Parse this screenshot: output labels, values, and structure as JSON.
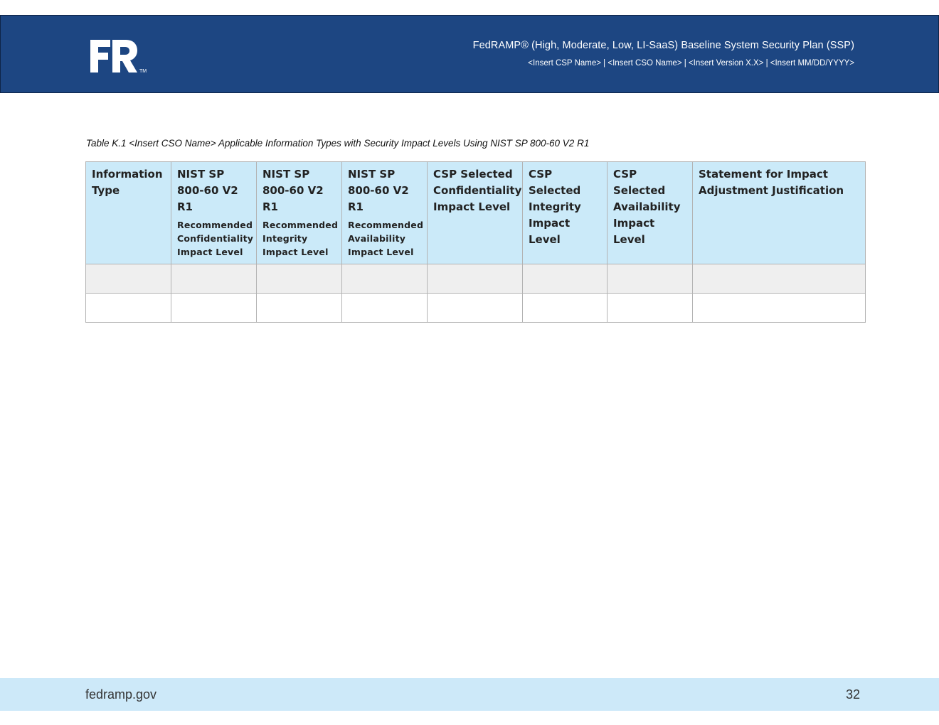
{
  "header": {
    "logo": "FR",
    "logo_tm": "TM",
    "title": "FedRAMP® (High, Moderate, Low, LI-SaaS) Baseline System Security Plan (SSP)",
    "subtitle": "<Insert CSP Name> | <Insert CSO Name> | <Insert Version X.X> | <Insert MM/DD/YYYY>"
  },
  "table": {
    "caption": "Table K.1 <Insert CSO Name> Applicable Information Types with Security Impact Levels Using NIST SP 800-60 V2 R1",
    "columns": [
      {
        "label": "Information Type",
        "sub": ""
      },
      {
        "label": "NIST SP 800-60 V2 R1",
        "sub": "Recommended Confidentiality Impact Level"
      },
      {
        "label": "NIST SP 800-60 V2 R1",
        "sub": "Recommended Integrity Impact Level"
      },
      {
        "label": "NIST SP 800-60 V2 R1",
        "sub": "Recommended Availability Impact Level"
      },
      {
        "label": "CSP Selected Confidentiality Impact Level",
        "sub": ""
      },
      {
        "label": "CSP Selected Integrity Impact Level",
        "sub": ""
      },
      {
        "label": "CSP Selected Availability Impact Level",
        "sub": ""
      },
      {
        "label": "Statement for Impact Adjustment Justification",
        "sub": ""
      }
    ],
    "rows": [
      [
        "",
        "",
        "",
        "",
        "",
        "",
        "",
        ""
      ],
      [
        "",
        "",
        "",
        "",
        "",
        "",
        "",
        ""
      ]
    ]
  },
  "footer": {
    "site": "fedramp.gov",
    "page_number": "32"
  },
  "colors": {
    "banner": "#1d4682",
    "header_cell": "#cbeaf9",
    "footer": "#cde9f9"
  }
}
